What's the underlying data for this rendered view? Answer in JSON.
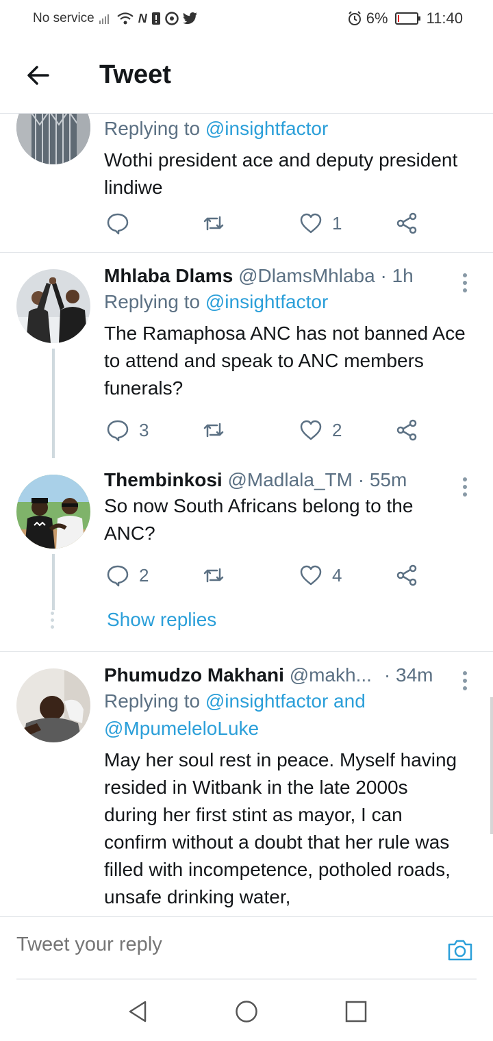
{
  "status_bar": {
    "carrier": "No service",
    "battery": "6%",
    "battery_level": 0.06,
    "time": "11:40"
  },
  "header": {
    "title": "Tweet"
  },
  "tweets": [
    {
      "reply_prefix": "Replying to",
      "reply_to": "@insightfactor",
      "text": "Wothi president ace and deputy president lindiwe",
      "replies": "",
      "retweets": "",
      "likes": "1"
    },
    {
      "name": "Mhlaba Dlams",
      "handle": "@DlamsMhlaba",
      "time": "· 1h",
      "reply_prefix": "Replying to",
      "reply_to": "@insightfactor",
      "text": "The Ramaphosa ANC has not banned Ace to attend and speak to ANC members funerals?",
      "replies": "3",
      "retweets": "",
      "likes": "2"
    },
    {
      "name": "Thembinkosi",
      "handle": "@Madlala_TM",
      "time": "· 55m",
      "text": "So now South Africans belong to the ANC?",
      "replies": "2",
      "retweets": "",
      "likes": "4",
      "show_replies": "Show replies"
    },
    {
      "name": "Phumudzo Makhani",
      "handle": "@makh...",
      "time": "· 34m",
      "reply_prefix": "Replying to",
      "reply_to": "@insightfactor and",
      "reply_to_2": "@MpumeleloLuke",
      "text": "May her soul rest in peace. Myself having resided in Witbank in the late 2000s during her first stint as mayor, I can confirm without a doubt that her rule was filled with incompetence, potholed roads, unsafe drinking water,"
    }
  ],
  "reply_bar": {
    "placeholder": "Tweet your reply"
  },
  "icons": {
    "back": "arrow-left-icon",
    "reply": "speech-bubble-icon",
    "retweet": "retweet-icon",
    "like": "heart-icon",
    "share": "share-icon",
    "more": "vertical-dots-icon",
    "camera": "camera-icon"
  },
  "colors": {
    "link": "#2b9fd9",
    "secondary_text": "#5b7083",
    "battery_low": "#e02020"
  }
}
